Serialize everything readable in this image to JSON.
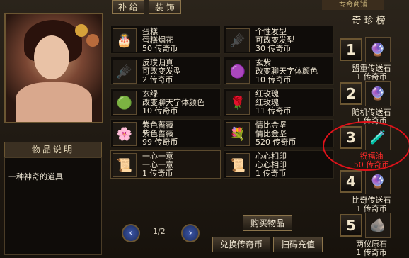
{
  "tabs": [
    "补 给",
    "装 饰"
  ],
  "top_banner": "专奇商铺",
  "left": {
    "section_title": "物品说明",
    "description": "一种神奇的道具"
  },
  "items": [
    {
      "name": "蛋糕",
      "desc": "蛋糕烟花",
      "price": "50 传奇币",
      "icon": "🎂",
      "sel": false
    },
    {
      "name": "个性发型",
      "desc": "可改变发型",
      "price": "30 传奇币",
      "icon": "🪮",
      "sel": false
    },
    {
      "name": "反璞归真",
      "desc": "可改变发型",
      "price": "2 传奇币",
      "icon": "🪮",
      "sel": false
    },
    {
      "name": "玄紫",
      "desc": "改变聊天字体颜色",
      "price": "10 传奇币",
      "icon": "🟣",
      "sel": false
    },
    {
      "name": "玄绿",
      "desc": "改变聊天字体颜色",
      "price": "10 传奇币",
      "icon": "🟢",
      "sel": false
    },
    {
      "name": "红玫瑰",
      "desc": "红玫瑰",
      "price": "11 传奇币",
      "icon": "🌹",
      "sel": false
    },
    {
      "name": "紫色蔷薇",
      "desc": "紫色蔷薇",
      "price": "99 传奇币",
      "icon": "🌸",
      "sel": false
    },
    {
      "name": "情比金坚",
      "desc": "情比金坚",
      "price": "520 传奇币",
      "icon": "💐",
      "sel": false
    },
    {
      "name": "一心一意",
      "desc": "一心一意",
      "price": "1 传奇币",
      "icon": "📜",
      "sel": true
    },
    {
      "name": "心心相印",
      "desc": "心心相印",
      "price": "1 传奇币",
      "icon": "📜",
      "sel": false
    }
  ],
  "pager": {
    "page": "1/2"
  },
  "buttons": {
    "buy": "购买物品",
    "exchange": "兑换传奇币",
    "recharge": "扫码充值"
  },
  "rank": {
    "title": "奇珍榜",
    "rows": [
      {
        "num": "1",
        "name": "盟重传送石",
        "price": "1 传奇币",
        "icon": "🔮",
        "red": false
      },
      {
        "num": "2",
        "name": "随机传送石",
        "price": "1 传奇币",
        "icon": "🔮",
        "red": false
      },
      {
        "num": "3",
        "name": "祝福油",
        "price": "50 传奇币",
        "icon": "🧪",
        "red": true
      },
      {
        "num": "4",
        "name": "比奇传送石",
        "price": "1 传奇币",
        "icon": "🔮",
        "red": false
      },
      {
        "num": "5",
        "name": "两仪原石",
        "price": "1 传奇币",
        "icon": "🪨",
        "red": false
      }
    ]
  }
}
